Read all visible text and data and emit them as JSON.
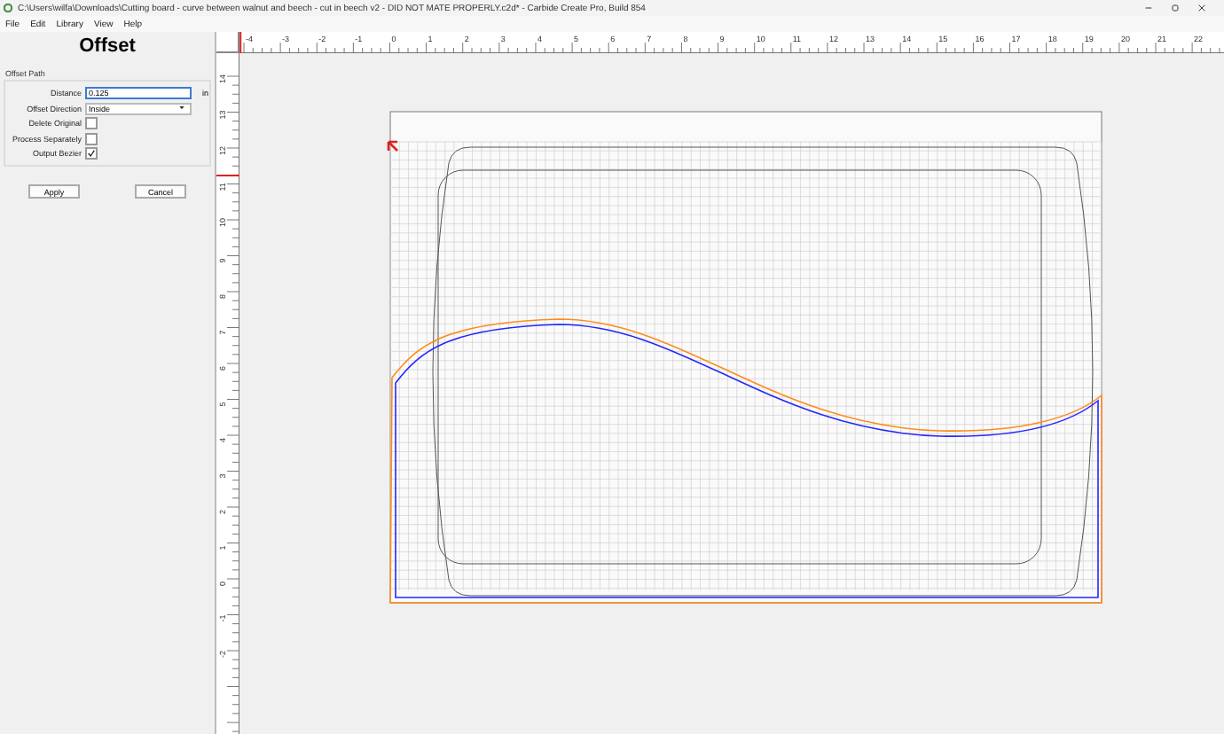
{
  "window": {
    "title": "C:\\Users\\wilfa\\Downloads\\Cutting board - curve between walnut and beech - cut in beech v2 - DID NOT MATE PROPERLY.c2d* - Carbide Create Pro, Build 854"
  },
  "menu": [
    "File",
    "Edit",
    "Library",
    "View",
    "Help"
  ],
  "panel": {
    "title": "Offset",
    "group_label": "Offset Path",
    "distance": {
      "label": "Distance",
      "value": "0.125",
      "unit": "in"
    },
    "direction": {
      "label": "Offset Direction",
      "value": "Inside"
    },
    "options": [
      {
        "label": "Delete Original",
        "checked": false
      },
      {
        "label": "Process Separately",
        "checked": false
      },
      {
        "label": "Output Bezier",
        "checked": true
      }
    ],
    "buttons": [
      "Apply",
      "Cancel"
    ]
  },
  "rulers": {
    "horizontal": [
      "-4",
      "-3",
      "-2",
      "-1",
      "0",
      "1",
      "2",
      "3",
      "4",
      "5",
      "6",
      "7",
      "8",
      "9",
      "10",
      "11",
      "12",
      "13",
      "14",
      "15",
      "16",
      "17",
      "18",
      "19",
      "20",
      "21",
      "22"
    ],
    "vertical": [
      "14",
      "13",
      "12",
      "11",
      "10",
      "9",
      "8",
      "7",
      "6",
      "5",
      "4",
      "3",
      "2",
      "1",
      "0",
      "-1",
      "-2"
    ]
  }
}
